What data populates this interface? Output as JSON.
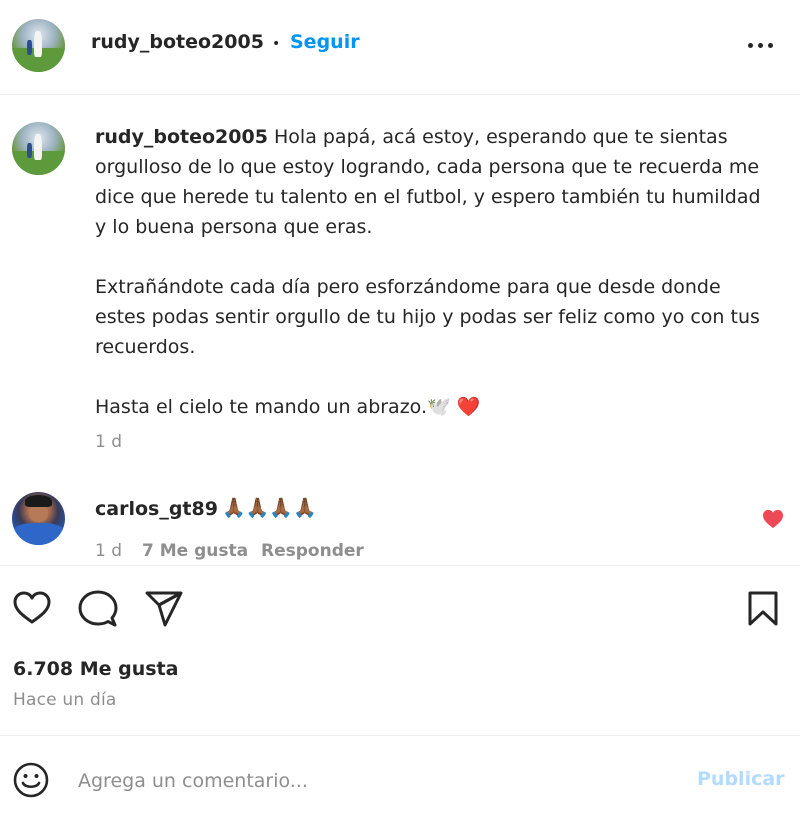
{
  "post": {
    "author": "rudy_boteo2005",
    "separator": "•",
    "follow_label": "Seguir",
    "more_icon": "more-horizontal-icon"
  },
  "caption": {
    "user": "rudy_boteo2005",
    "paragraph1": "Hola papá, acá estoy, esperando que te sientas orgulloso de lo que estoy logrando, cada persona que te recuerda me dice que herede tu talento en el futbol, y espero también tu humildad y lo buena persona que eras.",
    "paragraph2": "Extrañándote cada día pero esforzándome para que desde donde estes podas sentir orgullo de tu hijo y podas ser feliz como yo con tus recuerdos.",
    "paragraph3": "Hasta el cielo te mando un abrazo.🕊️ ❤️",
    "time": "1 d"
  },
  "comment": {
    "user": "carlos_gt89",
    "text": "🙏🏾🙏🏾🙏🏾🙏🏾",
    "time": "1 d",
    "likes": "7 Me gusta",
    "reply_label": "Responder",
    "liked_color": "#ed4956"
  },
  "actions": {
    "like_icon": "heart-icon",
    "comment_icon": "comment-icon",
    "share_icon": "send-icon",
    "save_icon": "bookmark-icon"
  },
  "stats": {
    "likes": "6.708 Me gusta",
    "date": "Hace un día"
  },
  "composer": {
    "emoji_icon": "emoji-icon",
    "placeholder": "Agrega un comentario...",
    "publish_label": "Publicar"
  }
}
